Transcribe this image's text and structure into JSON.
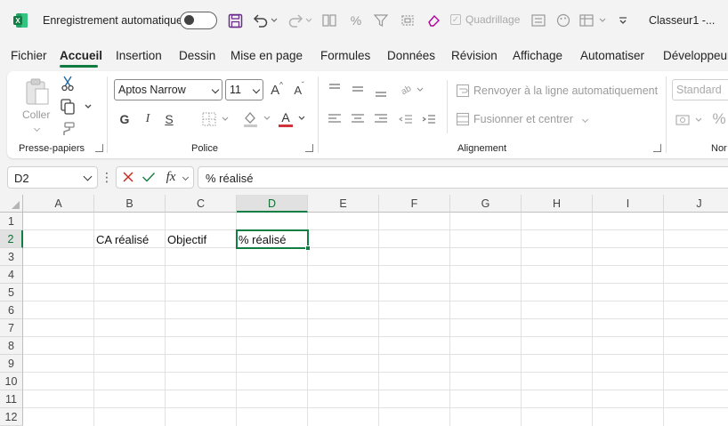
{
  "titlebar": {
    "autosave_label": "Enregistrement automatique",
    "gridlines_label": "Quadrillage",
    "document_title": "Classeur1  -..."
  },
  "menu": {
    "tabs": [
      "Fichier",
      "Accueil",
      "Insertion",
      "Dessin",
      "Mise en page",
      "Formules",
      "Données",
      "Révision",
      "Affichage",
      "Automatiser",
      "Développeur"
    ],
    "active": "Accueil"
  },
  "ribbon": {
    "clipboard": {
      "paste_label": "Coller",
      "group_label": "Presse-papiers"
    },
    "font": {
      "font_name": "Aptos Narrow",
      "font_size": "11",
      "bold": "G",
      "italic": "I",
      "underline": "S",
      "group_label": "Police"
    },
    "alignment": {
      "wrap_label": "Renvoyer à la ligne automatiquement",
      "merge_label": "Fusionner et centrer",
      "group_label": "Alignement"
    },
    "number": {
      "format": "Standard",
      "percent": "%",
      "group_label": "Nor"
    }
  },
  "formula_bar": {
    "name_box": "D2",
    "formula": "% réalisé"
  },
  "grid": {
    "columns": [
      "A",
      "B",
      "C",
      "D",
      "E",
      "F",
      "G",
      "H",
      "I",
      "J"
    ],
    "rows": [
      "1",
      "2",
      "3",
      "4",
      "5",
      "6",
      "7",
      "8",
      "9",
      "10",
      "11",
      "12"
    ],
    "selected_column": "D",
    "selected_row": "2",
    "cells": {
      "B2": "CA réalisé",
      "C2": "Objectif",
      "D2": "% réalisé"
    }
  },
  "colors": {
    "accent": "#137e43",
    "excel_green": "#107c41",
    "save_purple": "#6b2d8a",
    "font_color_red": "#d13438"
  }
}
